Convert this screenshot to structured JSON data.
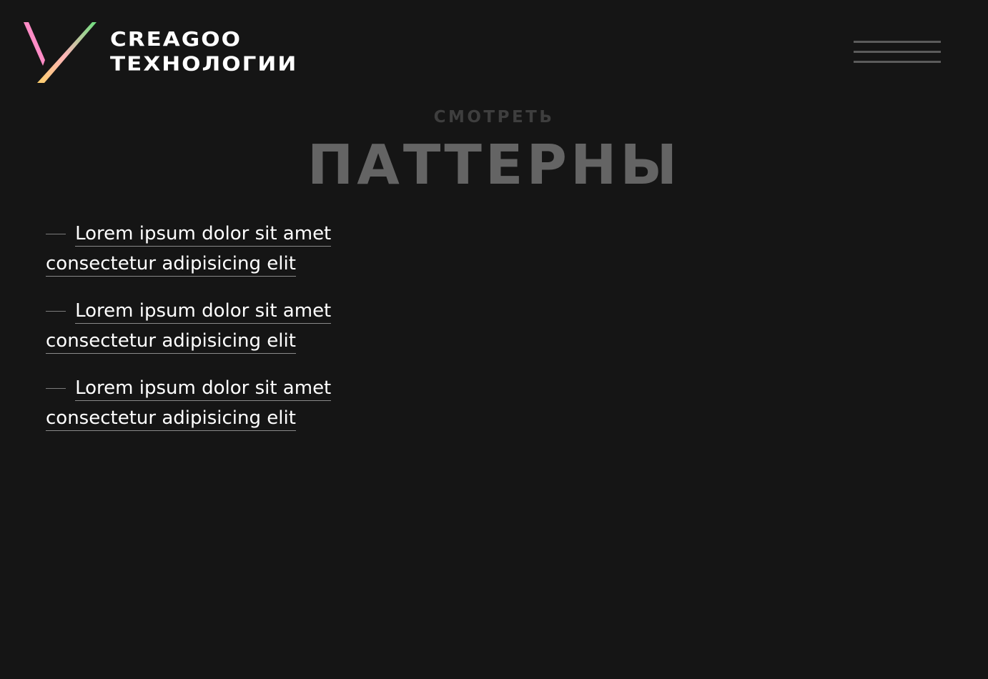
{
  "header": {
    "logo_line_1": "CREAGOO",
    "logo_line_2": "ТЕХНОЛОГИИ",
    "logo_colors": {
      "pink": "#ff8cc6",
      "yellow": "#ffd06c",
      "green": "#6de07e"
    },
    "menu_icon": "hamburger-menu-icon"
  },
  "hero": {
    "kicker": "СМОТРЕТЬ",
    "title": "ПАТТЕРНЫ"
  },
  "links": [
    {
      "label": "Lorem ipsum dolor sit amet consectetur adipisicing elit"
    },
    {
      "label": "Lorem ipsum dolor sit amet consectetur adipisicing elit"
    },
    {
      "label": "Lorem ipsum dolor sit amet consectetur adipisicing elit"
    }
  ],
  "colors": {
    "background": "#151515",
    "text": "#ffffff",
    "muted_title": "#646464",
    "muted_kicker": "#3e3e3e",
    "menu_lines": "#5b5b5b",
    "dash": "#7b7b7b"
  }
}
